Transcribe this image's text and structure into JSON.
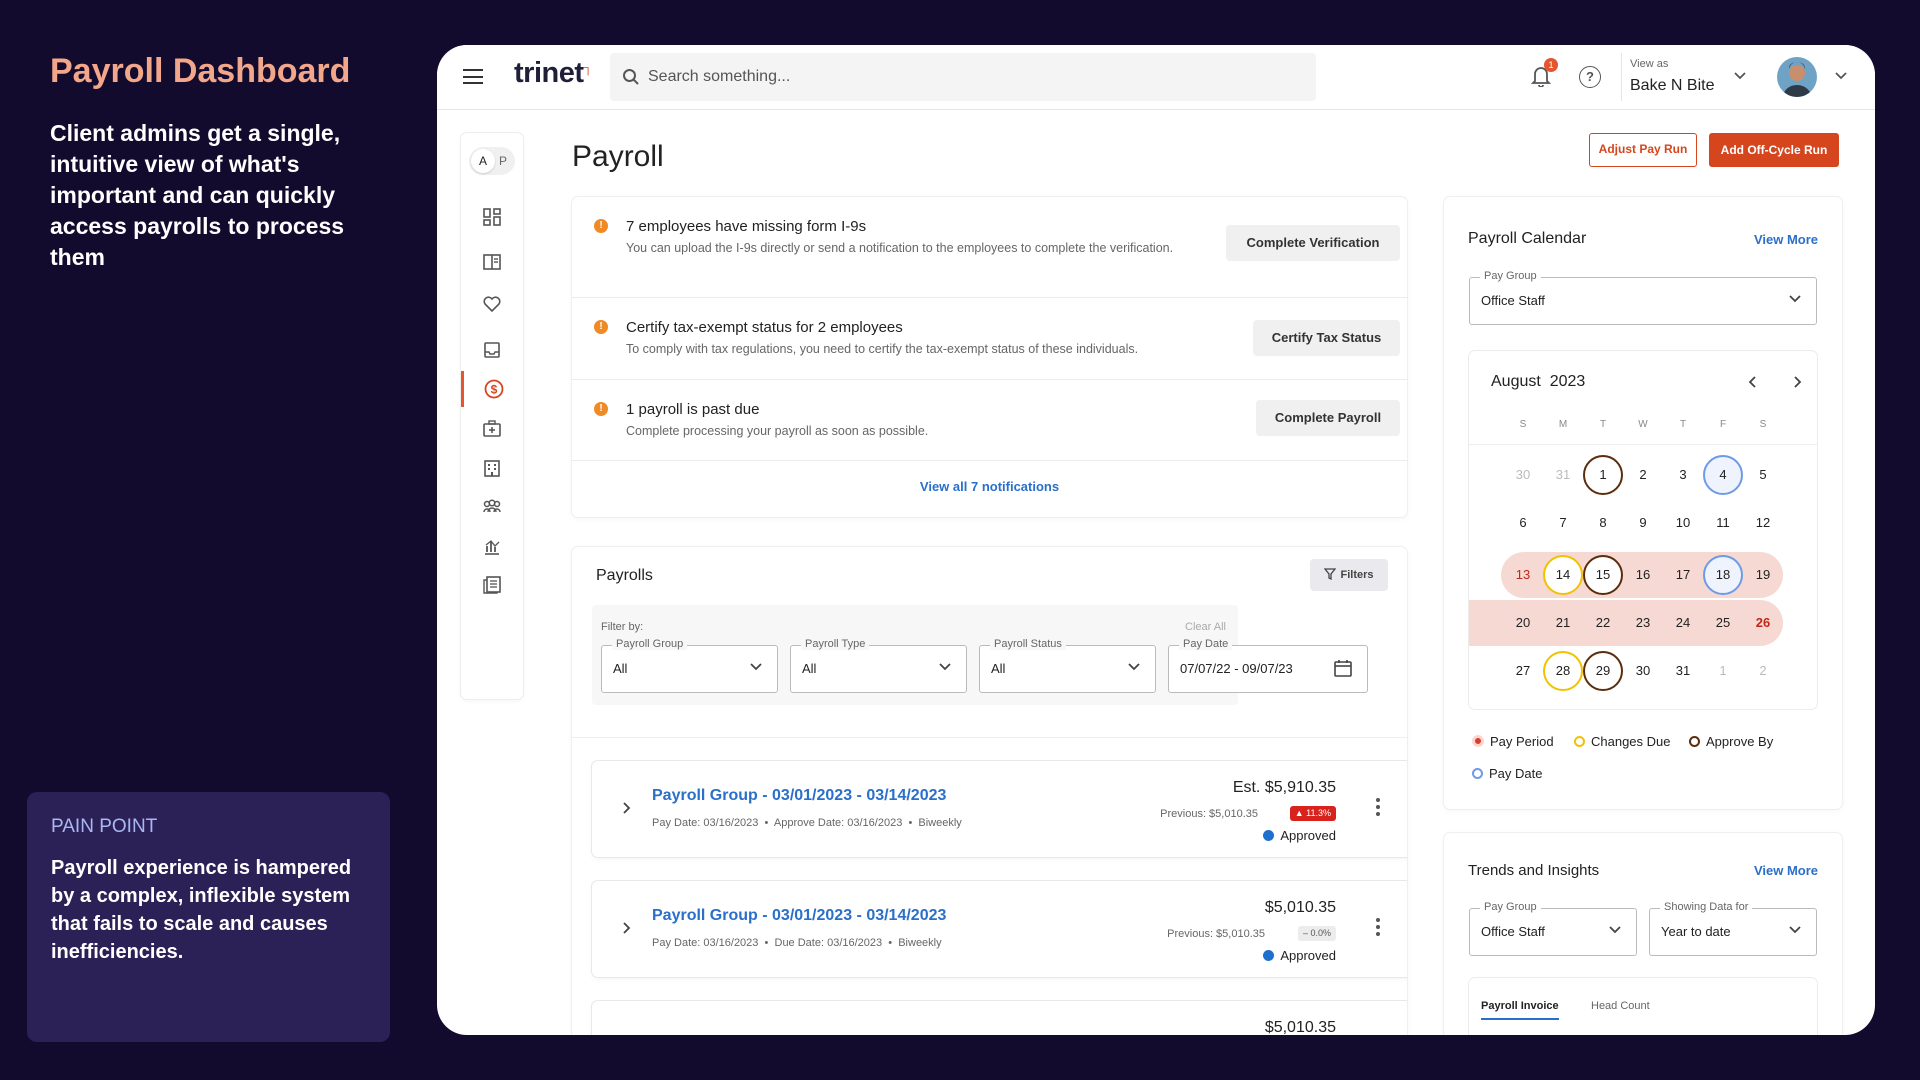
{
  "hero": {
    "title": "Payroll Dashboard",
    "description": "Client admins get a single, intuitive view of what's important and can quickly access payrolls to process them"
  },
  "pain_point": {
    "label": "PAIN POINT",
    "text": "Payroll experience is hampered by a complex, inflexible system that fails to scale and causes inefficiencies."
  },
  "topbar": {
    "logo": "trinet",
    "search_placeholder": "Search something...",
    "notification_count": "1",
    "help": "?",
    "view_as_label": "View as",
    "view_as_value": "Bake N Bite"
  },
  "sidenav": {
    "toggle_a": "A",
    "toggle_p": "P"
  },
  "page": {
    "title": "Payroll",
    "adjust_button": "Adjust Pay Run",
    "offcycle_button": "Add Off-Cycle Run"
  },
  "notifications": {
    "items": [
      {
        "title": "7 employees have missing form I-9s",
        "text": "You can upload the I-9s directly or send a notification to the employees to complete the verification.",
        "action": "Complete Verification"
      },
      {
        "title": "Certify tax-exempt status for 2 employees",
        "text": "To comply with tax regulations, you need to certify the tax-exempt status of these individuals.",
        "action": "Certify Tax Status"
      },
      {
        "title": "1 payroll is past due",
        "text": "Complete processing your payroll as soon as possible.",
        "action": "Complete Payroll"
      }
    ],
    "view_all": "View all 7 notifications"
  },
  "payrolls": {
    "title": "Payrolls",
    "filters_button": "Filters",
    "filter_by": "Filter by:",
    "clear_all": "Clear All",
    "filters": [
      {
        "label": "Payroll Group",
        "value": "All"
      },
      {
        "label": "Payroll Type",
        "value": "All"
      },
      {
        "label": "Payroll Status",
        "value": "All"
      },
      {
        "label": "Pay Date",
        "value": "07/07/22 - 09/07/23"
      }
    ],
    "rows": [
      {
        "name": "Payroll Group - 03/01/2023 - 03/14/2023",
        "pay_date": "Pay Date: 03/16/2023",
        "second_date": "Approve Date: 03/16/2023",
        "frequency": "Biweekly",
        "amount": "Est. $5,910.35",
        "previous": "Previous: $5,010.35",
        "change": "▲ 11.3%",
        "status": "Approved"
      },
      {
        "name": "Payroll Group - 03/01/2023 - 03/14/2023",
        "pay_date": "Pay Date: 03/16/2023",
        "second_date": "Due Date: 03/16/2023",
        "frequency": "Biweekly",
        "amount": "$5,010.35",
        "previous": "Previous: $5,010.35",
        "change": "– 0.0%",
        "status": "Approved"
      },
      {
        "amount": "$5,010.35"
      }
    ]
  },
  "calendar": {
    "title": "Payroll Calendar",
    "view_more": "View More",
    "pay_group_label": "Pay Group",
    "pay_group_value": "Office Staff",
    "month": "August",
    "year": "2023",
    "weekdays": [
      "S",
      "M",
      "T",
      "W",
      "T",
      "F",
      "S"
    ],
    "weeks": [
      [
        "30",
        "31",
        "1",
        "2",
        "3",
        "4",
        "5"
      ],
      [
        "6",
        "7",
        "8",
        "9",
        "10",
        "11",
        "12"
      ],
      [
        "13",
        "14",
        "15",
        "16",
        "17",
        "18",
        "19"
      ],
      [
        "20",
        "21",
        "22",
        "23",
        "24",
        "25",
        "26"
      ],
      [
        "27",
        "28",
        "29",
        "30",
        "31",
        "1",
        "2"
      ]
    ],
    "legend": [
      "Pay Period",
      "Changes Due",
      "Approve By",
      "Pay Date"
    ],
    "colors": {
      "pay_period": "#e03a2a",
      "changes_due": "#f2c200",
      "approve_by": "#5a2d0c",
      "pay_date": "#6f9ae6"
    }
  },
  "trends": {
    "title": "Trends and Insights",
    "view_more": "View More",
    "pay_group_label": "Pay Group",
    "pay_group_value": "Office Staff",
    "showing_label": "Showing Data for",
    "showing_value": "Year to date",
    "tabs": [
      "Payroll Invoice",
      "Head Count"
    ]
  },
  "colors": {
    "accent": "#d5461f",
    "link": "#2a6fc9",
    "background": "#130b2e"
  }
}
